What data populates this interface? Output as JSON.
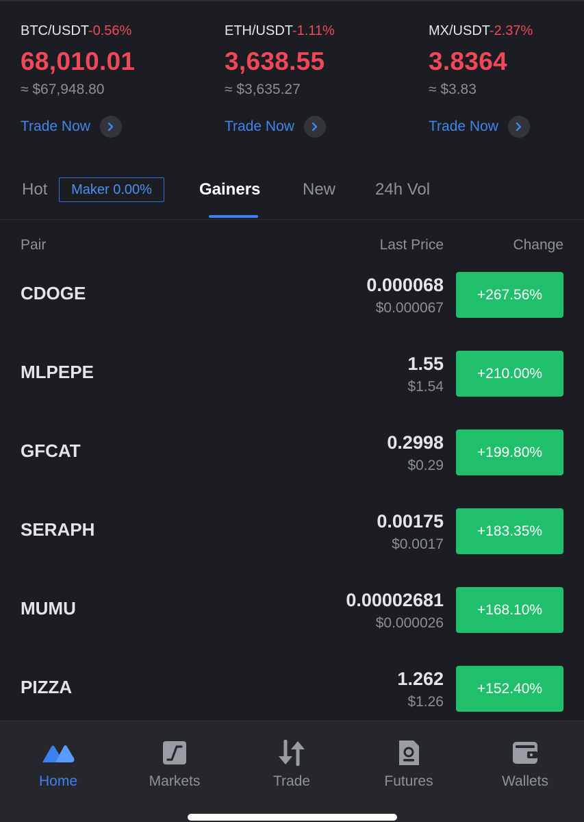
{
  "tickers": [
    {
      "pair": "BTC/USDT",
      "change": "-0.56%",
      "price": "68,010.01",
      "usd": "≈ $67,948.80",
      "trade_label": "Trade Now"
    },
    {
      "pair": "ETH/USDT",
      "change": "-1.11%",
      "price": "3,638.55",
      "usd": "≈ $3,635.27",
      "trade_label": "Trade Now"
    },
    {
      "pair": "MX/USDT",
      "change": "-2.37%",
      "price": "3.8364",
      "usd": "≈ $3.83",
      "trade_label": "Trade Now"
    }
  ],
  "tabs": {
    "hot": "Hot",
    "maker_badge": "Maker 0.00%",
    "gainers": "Gainers",
    "new": "New",
    "vol": "24h Vol",
    "active": "Gainers"
  },
  "table": {
    "headers": {
      "pair": "Pair",
      "last_price": "Last Price",
      "change": "Change"
    },
    "rows": [
      {
        "symbol": "CDOGE",
        "last_price": "0.000068",
        "usd": "$0.000067",
        "change": "+267.56%"
      },
      {
        "symbol": "MLPEPE",
        "last_price": "1.55",
        "usd": "$1.54",
        "change": "+210.00%"
      },
      {
        "symbol": "GFCAT",
        "last_price": "0.2998",
        "usd": "$0.29",
        "change": "+199.80%"
      },
      {
        "symbol": "SERAPH",
        "last_price": "0.00175",
        "usd": "$0.0017",
        "change": "+183.35%"
      },
      {
        "symbol": "MUMU",
        "last_price": "0.00002681",
        "usd": "$0.000026",
        "change": "+168.10%"
      },
      {
        "symbol": "PIZZA",
        "last_price": "1.262",
        "usd": "$1.26",
        "change": "+152.40%"
      }
    ]
  },
  "nav": {
    "items": [
      {
        "label": "Home",
        "icon": "mexc-logo-icon",
        "active": true
      },
      {
        "label": "Markets",
        "icon": "markets-chart-icon",
        "active": false
      },
      {
        "label": "Trade",
        "icon": "trade-arrows-icon",
        "active": false
      },
      {
        "label": "Futures",
        "icon": "futures-doc-icon",
        "active": false
      },
      {
        "label": "Wallets",
        "icon": "wallet-icon",
        "active": false
      }
    ]
  },
  "colors": {
    "background": "#1c1d22",
    "negative": "#f0475a",
    "positive_bg": "#1fbf6c",
    "accent": "#3b82f0",
    "muted": "#8f9199"
  }
}
